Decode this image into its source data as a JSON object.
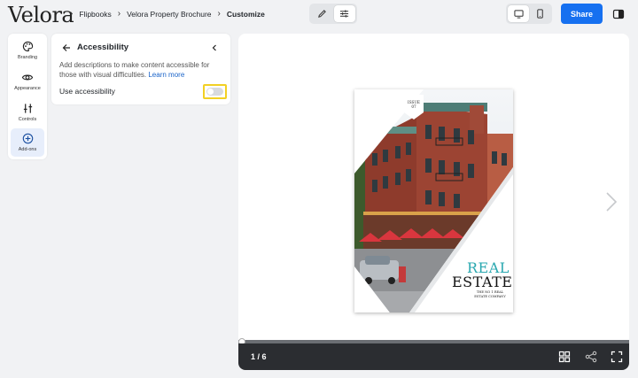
{
  "brand": {
    "logo_text": "Velora"
  },
  "breadcrumb": [
    {
      "label": "Flipbooks"
    },
    {
      "label": "Velora Property Brochure"
    },
    {
      "label": "Customize"
    }
  ],
  "header": {
    "share_label": "Share"
  },
  "rail": {
    "items": [
      {
        "label": "Branding",
        "icon": "palette-icon"
      },
      {
        "label": "Appearance",
        "icon": "eye-icon"
      },
      {
        "label": "Controls",
        "icon": "sliders-icon"
      },
      {
        "label": "Add-ons",
        "icon": "plus-circle-icon",
        "active": true
      }
    ]
  },
  "panel": {
    "title": "Accessibility",
    "description": "Add descriptions to make content accessible for those with visual difficulties.",
    "learn_more": "Learn more",
    "toggle_label": "Use accessibility",
    "toggle_on": false
  },
  "cover": {
    "issue_line1": "ISSUE",
    "issue_line2": "07",
    "title_line1": "REAL",
    "title_line2": "ESTATE",
    "subtitle": "THE NO 1 REAL ESTATE COMPANY"
  },
  "viewer": {
    "page_indicator": "1 / 6",
    "progress": 0
  },
  "colors": {
    "accent": "#1670f0",
    "highlight": "#f2d024",
    "cover_accent": "#2aa8b0"
  }
}
